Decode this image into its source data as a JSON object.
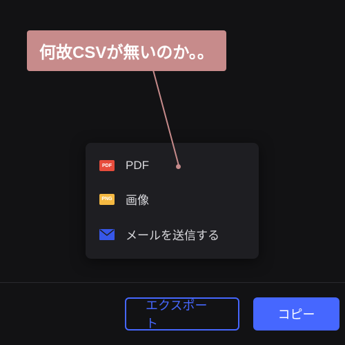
{
  "annotation": {
    "text": "何故CSVが無いのか。。"
  },
  "menu": {
    "items": [
      {
        "icon_label": "PDF",
        "label": "PDF"
      },
      {
        "icon_label": "PNG",
        "label": "画像"
      },
      {
        "icon_label": "",
        "label": "メールを送信する"
      }
    ]
  },
  "footer": {
    "export_label": "エクスポート",
    "copy_label": "コピー"
  }
}
